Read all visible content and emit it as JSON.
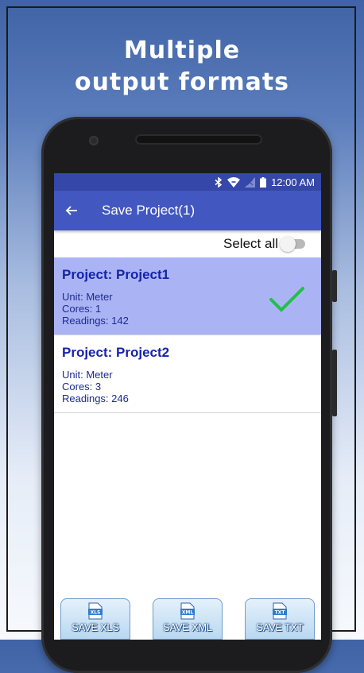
{
  "promo": {
    "headline_line1": "Multiple",
    "headline_line2": "output formats"
  },
  "status_bar": {
    "time": "12:00 AM",
    "icons": [
      "bluetooth-icon",
      "wifi-icon",
      "signal-icon",
      "battery-icon"
    ]
  },
  "app_bar": {
    "title": "Save Project(1)",
    "back_icon": "arrow-left-icon"
  },
  "select_all": {
    "label": "Select all",
    "enabled": false
  },
  "projects": [
    {
      "name": "Project: Project1",
      "unit": "Unit: Meter",
      "cores": "Cores: 1",
      "readings": "Readings: 142",
      "selected": true
    },
    {
      "name": "Project: Project2",
      "unit": "Unit: Meter",
      "cores": "Cores: 3",
      "readings": "Readings: 246",
      "selected": false
    }
  ],
  "export_buttons": [
    {
      "label": "SAVE XLS",
      "icon_text": "XLS"
    },
    {
      "label": "SAVE XML",
      "icon_text": "XML"
    },
    {
      "label": "SAVE TXT",
      "icon_text": "TXT"
    }
  ],
  "colors": {
    "status_bar": "#3547a8",
    "app_bar": "#4357c0",
    "selected_row": "#aab4f5",
    "project_name": "#1524a8",
    "checkmark": "#22c04a"
  }
}
